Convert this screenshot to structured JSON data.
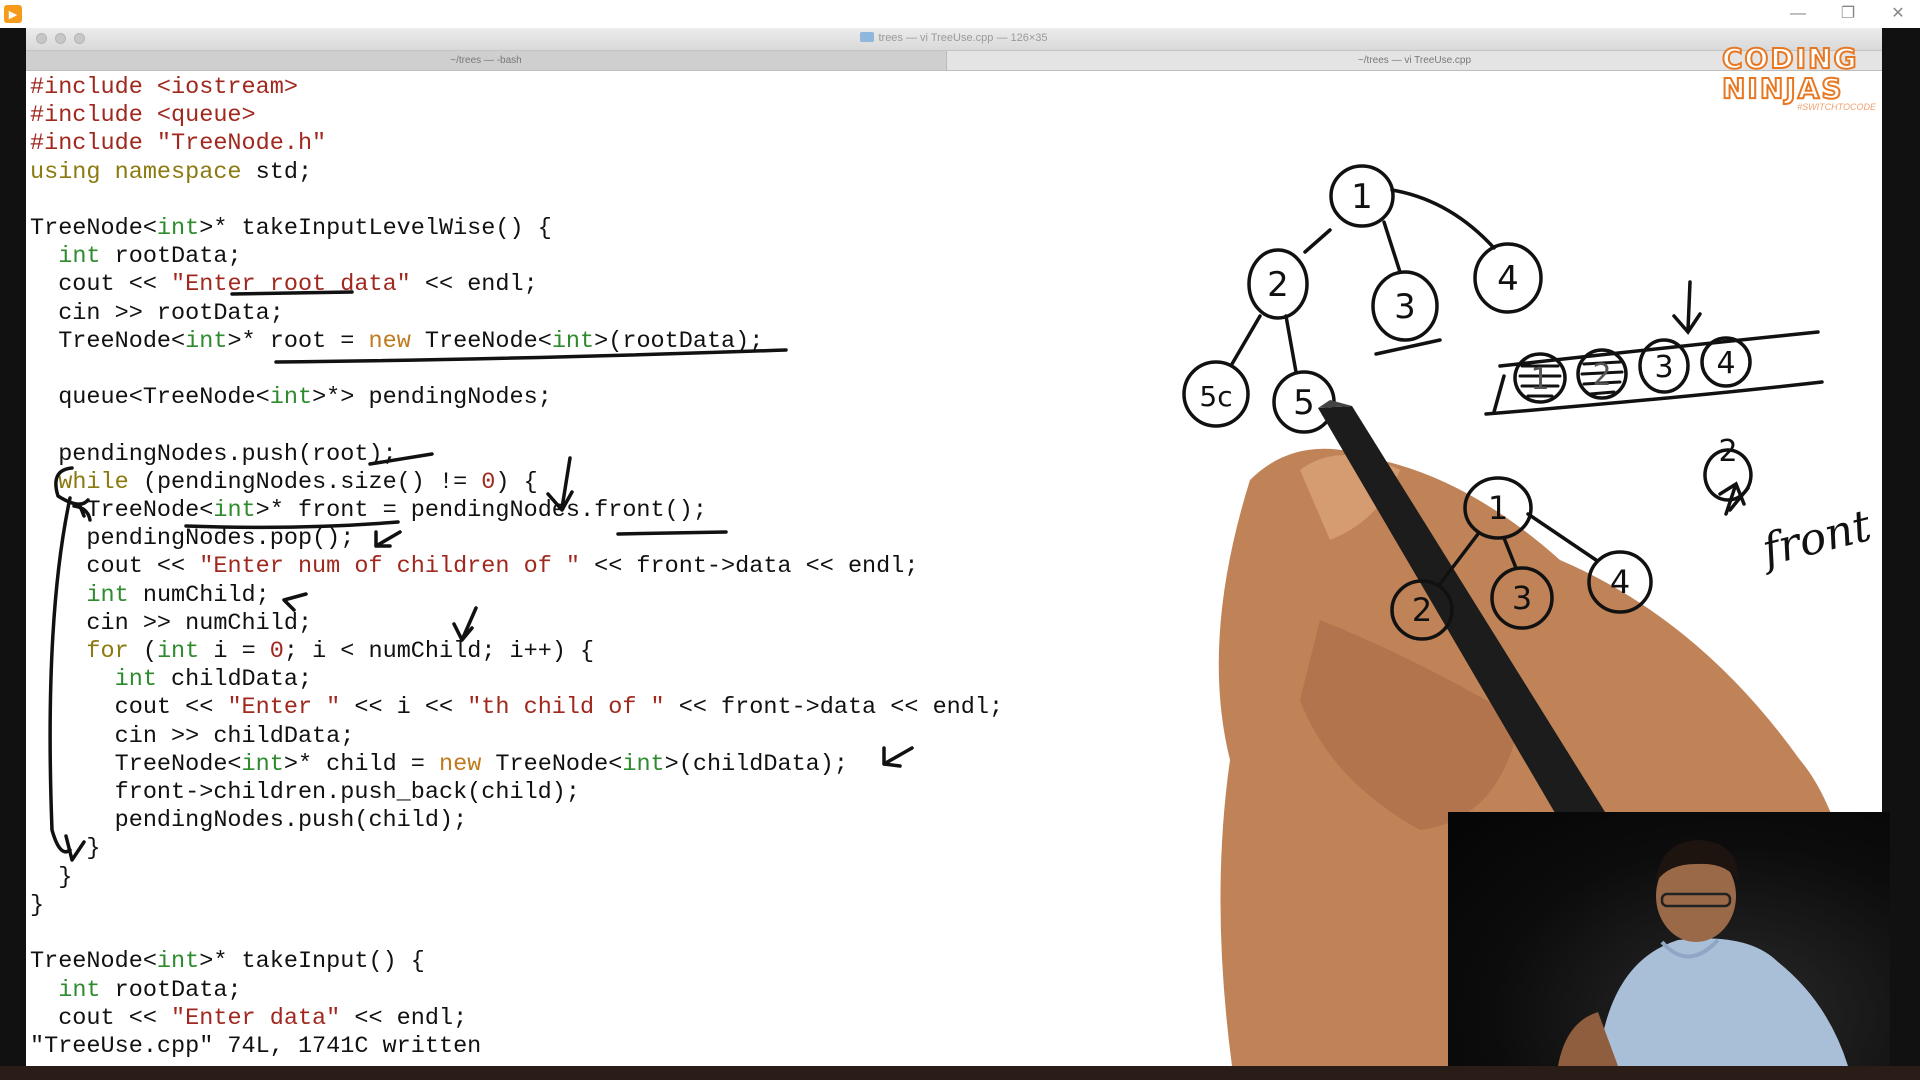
{
  "player": {
    "controls": [
      "minimize",
      "restore",
      "close"
    ]
  },
  "terminal": {
    "window_title": "trees — vi TreeUse.cpp — 126×35",
    "tabs": [
      "~/trees — -bash",
      "~/trees — vi TreeUse.cpp"
    ],
    "status_line": "\"TreeUse.cpp\" 74L, 1741C written"
  },
  "logo": {
    "line1": "CODING",
    "line2": "NINJAS",
    "tagline": "#SWITCHTOCODE"
  },
  "code_lines": [
    [
      {
        "t": "#include <iostream>",
        "c": "st"
      }
    ],
    [
      {
        "t": "#include <queue>",
        "c": "st"
      }
    ],
    [
      {
        "t": "#include \"TreeNode.h\"",
        "c": "st"
      }
    ],
    [
      {
        "t": "using namespace",
        "c": "kw"
      },
      {
        "t": " std;",
        "c": ""
      }
    ],
    [],
    [
      {
        "t": "TreeNode<",
        "c": ""
      },
      {
        "t": "int",
        "c": "ty"
      },
      {
        "t": ">* takeInputLevelWise() {",
        "c": ""
      }
    ],
    [
      {
        "t": "  ",
        "c": ""
      },
      {
        "t": "int",
        "c": "ty"
      },
      {
        "t": " rootData;",
        "c": ""
      }
    ],
    [
      {
        "t": "  cout << ",
        "c": ""
      },
      {
        "t": "\"Enter root data\"",
        "c": "st"
      },
      {
        "t": " << endl;",
        "c": ""
      }
    ],
    [
      {
        "t": "  cin >> rootData;",
        "c": ""
      }
    ],
    [
      {
        "t": "  TreeNode<",
        "c": ""
      },
      {
        "t": "int",
        "c": "ty"
      },
      {
        "t": ">* root = ",
        "c": ""
      },
      {
        "t": "new",
        "c": "nw"
      },
      {
        "t": " TreeNode<",
        "c": ""
      },
      {
        "t": "int",
        "c": "ty"
      },
      {
        "t": ">(rootData);",
        "c": ""
      }
    ],
    [],
    [
      {
        "t": "  queue<TreeNode<",
        "c": ""
      },
      {
        "t": "int",
        "c": "ty"
      },
      {
        "t": ">*> pendingNodes;",
        "c": ""
      }
    ],
    [],
    [
      {
        "t": "  pendingNodes.push(root);",
        "c": ""
      }
    ],
    [
      {
        "t": "  ",
        "c": ""
      },
      {
        "t": "while",
        "c": "kw"
      },
      {
        "t": " (pendingNodes.size() != ",
        "c": ""
      },
      {
        "t": "0",
        "c": "nm"
      },
      {
        "t": ") {",
        "c": ""
      }
    ],
    [
      {
        "t": "    TreeNode<",
        "c": ""
      },
      {
        "t": "int",
        "c": "ty"
      },
      {
        "t": ">* front = pendingNodes.front();",
        "c": ""
      }
    ],
    [
      {
        "t": "    pendingNodes.pop();",
        "c": ""
      }
    ],
    [
      {
        "t": "    cout << ",
        "c": ""
      },
      {
        "t": "\"Enter num of children of \"",
        "c": "st"
      },
      {
        "t": " << front->data << endl;",
        "c": ""
      }
    ],
    [
      {
        "t": "    ",
        "c": ""
      },
      {
        "t": "int",
        "c": "ty"
      },
      {
        "t": " numChild;",
        "c": ""
      }
    ],
    [
      {
        "t": "    cin >> numChild;",
        "c": ""
      }
    ],
    [
      {
        "t": "    ",
        "c": ""
      },
      {
        "t": "for",
        "c": "kw"
      },
      {
        "t": " (",
        "c": ""
      },
      {
        "t": "int",
        "c": "ty"
      },
      {
        "t": " i = ",
        "c": ""
      },
      {
        "t": "0",
        "c": "nm"
      },
      {
        "t": "; i < numChild; i++) {",
        "c": ""
      }
    ],
    [
      {
        "t": "      ",
        "c": ""
      },
      {
        "t": "int",
        "c": "ty"
      },
      {
        "t": " childData;",
        "c": ""
      }
    ],
    [
      {
        "t": "      cout << ",
        "c": ""
      },
      {
        "t": "\"Enter \"",
        "c": "st"
      },
      {
        "t": " << i << ",
        "c": ""
      },
      {
        "t": "\"th child of \"",
        "c": "st"
      },
      {
        "t": " << front->data << endl;",
        "c": ""
      }
    ],
    [
      {
        "t": "      cin >> childData;",
        "c": ""
      }
    ],
    [
      {
        "t": "      TreeNode<",
        "c": ""
      },
      {
        "t": "int",
        "c": "ty"
      },
      {
        "t": ">* child = ",
        "c": ""
      },
      {
        "t": "new",
        "c": "nw"
      },
      {
        "t": " TreeNode<",
        "c": ""
      },
      {
        "t": "int",
        "c": "ty"
      },
      {
        "t": ">(childData);",
        "c": ""
      }
    ],
    [
      {
        "t": "      front->children.push_back(child);",
        "c": ""
      }
    ],
    [
      {
        "t": "      pendingNodes.push(child);",
        "c": ""
      }
    ],
    [
      {
        "t": "    }",
        "c": ""
      }
    ],
    [
      {
        "t": "  }",
        "c": ""
      }
    ],
    [
      {
        "t": "}",
        "c": ""
      }
    ],
    [],
    [
      {
        "t": "TreeNode<",
        "c": ""
      },
      {
        "t": "int",
        "c": "ty"
      },
      {
        "t": ">* takeInput() {",
        "c": ""
      }
    ],
    [
      {
        "t": "  ",
        "c": ""
      },
      {
        "t": "int",
        "c": "ty"
      },
      {
        "t": " rootData;",
        "c": ""
      }
    ],
    [
      {
        "t": "  cout << ",
        "c": ""
      },
      {
        "t": "\"Enter data\"",
        "c": "st"
      },
      {
        "t": " << endl;",
        "c": ""
      }
    ]
  ],
  "sketch": {
    "tree1_nodes": [
      "1",
      "2",
      "3",
      "4",
      "5c",
      "5"
    ],
    "queue_items": [
      "1",
      "2",
      "3",
      "4"
    ],
    "front_node": "2",
    "front_label": "front",
    "tree2_nodes": [
      "1",
      "2",
      "3",
      "4"
    ]
  }
}
